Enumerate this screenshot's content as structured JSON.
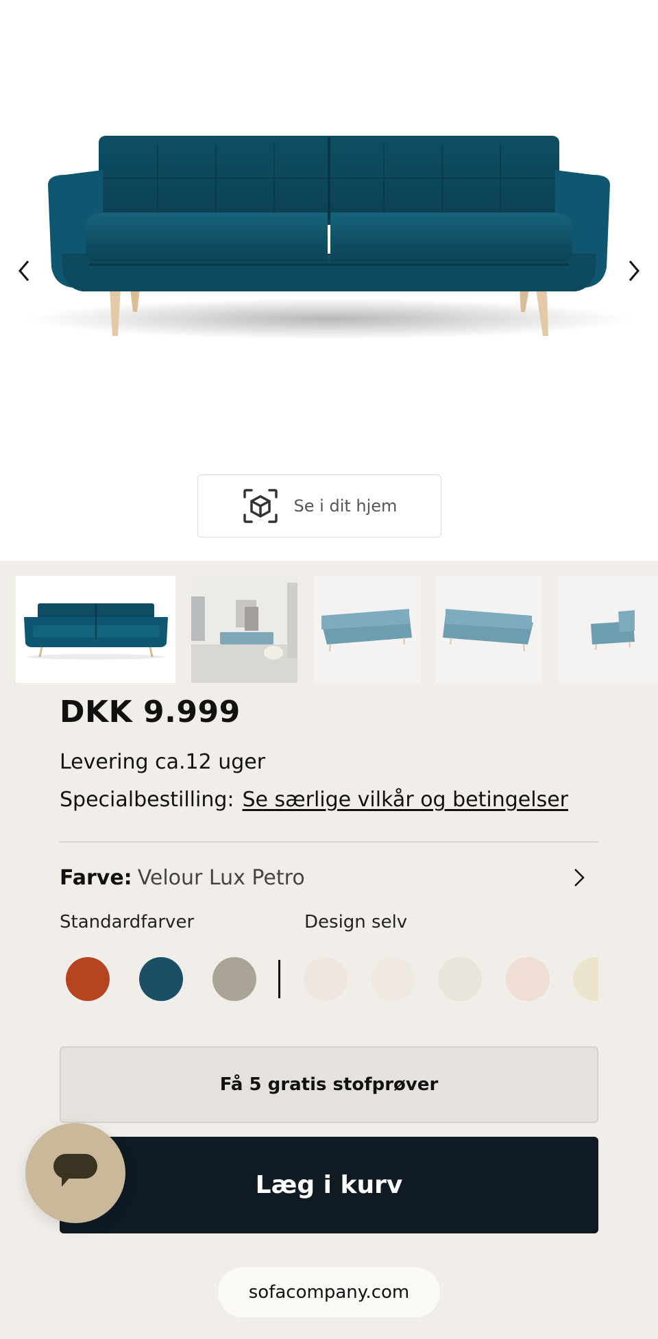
{
  "gallery": {
    "ar_button_label": "Se i dit hjem",
    "sofa_color": "#0f4f63",
    "thumbnails": [
      "front-view",
      "room-view",
      "angle-left-view",
      "angle-right-view",
      "armchair-view"
    ]
  },
  "product": {
    "price": "DKK 9.999",
    "delivery": "Levering ca.12 uger",
    "special_order_label": "Specialbestilling:",
    "special_order_link": "Se særlige vilkår og betingelser"
  },
  "color": {
    "label": "Farve:",
    "value": "Velour Lux Petro",
    "standard_label": "Standardfarver",
    "design_label": "Design selv",
    "standard_swatches": [
      "#b5441f",
      "#1a4f66",
      "#aaa497"
    ],
    "design_swatches": [
      "#efe7df",
      "#f0e9e1",
      "#e9e5dc",
      "#f0ddd3",
      "#ebe4cc"
    ]
  },
  "actions": {
    "samples_label": "Få 5 gratis stofprøver",
    "add_to_cart_label": "Læg i kurv"
  },
  "footer": {
    "url": "sofacompany.com"
  }
}
